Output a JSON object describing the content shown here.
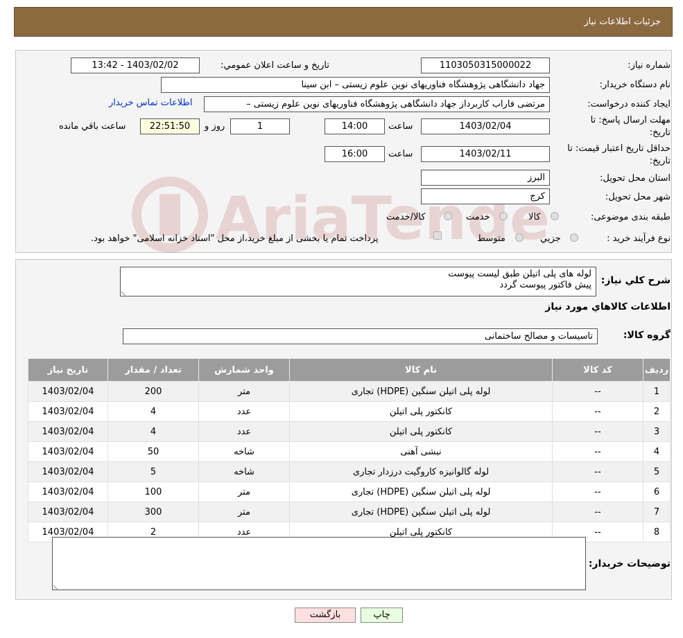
{
  "header": {
    "title": "جزئیات اطلاعات نیاز"
  },
  "form": {
    "need_number_label": "شماره نیاز:",
    "need_number": "1103050315000022",
    "announce_label": "تاریخ و ساعت اعلان عمومي:",
    "announce_value": "1403/02/02 - 13:42",
    "buyer_org_label": "نام دستگاه خريدار:",
    "buyer_org": "جهاد دانشگاهی پژوهشگاه فناوریهای نوین علوم زیستی – ابن سینا",
    "requester_label": "ايجاد كننده درخواست:",
    "requester": "مرتضی فاراب کاربرداز جهاد دانشگاهی پژوهشگاه فناوریهای نوین علوم زیستی –",
    "contact_link": "اطلاعات تماس خریدار",
    "deadline_label_1": "مهلت ارسال پاسخ: تا",
    "deadline_label_2": "تاریخ:",
    "deadline_date": "1403/02/04",
    "time_label": "ساعت",
    "deadline_time": "14:00",
    "days_value": "1",
    "days_label": "روز و",
    "remaining_time": "22:51:50",
    "remaining_label": "ساعت باقي مانده",
    "validity_label_1": "حداقل تاريخ اعتبار قيمت: تا",
    "validity_label_2": "تاریخ:",
    "validity_date": "1403/02/11",
    "validity_time": "16:00",
    "province_label": "استان محل تحویل:",
    "province": "البرز",
    "city_label": "شهر محل تحویل:",
    "city": "کرج",
    "category_label": "طبقه بندی موضوعی:",
    "category_options": [
      "کالا",
      "خدمت",
      "کالا/خدمت"
    ],
    "process_label": "نوع فرآیند خرید :",
    "process_options": [
      "جزیي",
      "متوسط"
    ],
    "process_note": "پرداخت تمام یا بخشی از مبلغ خرید،از محل \"اسناد خزانه اسلامی\" خواهد بود."
  },
  "description": {
    "label": "شرح كلي نياز:",
    "line1": "لوله های پلی اتیلن طبق لیست پیوست",
    "line2": "پیش فاکتور پیوست گردد"
  },
  "goods": {
    "section_title": "اطلاعات كالاهاي مورد نياز",
    "group_label": "گروه كالا:",
    "group_value": "تاسیسات و مصالح ساختمانی",
    "columns": [
      "رديف",
      "كد كالا",
      "نام كالا",
      "واحد شمارش",
      "تعداد / مقدار",
      "تاريخ نياز"
    ],
    "rows": [
      [
        "1",
        "--",
        "لوله پلی اتیلن سنگین (HDPE) تجاری",
        "متر",
        "200",
        "1403/02/04"
      ],
      [
        "2",
        "--",
        "کانکتور پلی اتیلن",
        "عدد",
        "4",
        "1403/02/04"
      ],
      [
        "3",
        "--",
        "کانکتور پلی اتیلن",
        "عدد",
        "4",
        "1403/02/04"
      ],
      [
        "4",
        "--",
        "نبشی آهنی",
        "شاخه",
        "50",
        "1403/02/04"
      ],
      [
        "5",
        "--",
        "لوله گالوانیزه کاروگیت درزدار تجاری",
        "شاخه",
        "5",
        "1403/02/04"
      ],
      [
        "6",
        "--",
        "لوله پلی اتیلن سنگین (HDPE) تجاری",
        "متر",
        "100",
        "1403/02/04"
      ],
      [
        "7",
        "--",
        "لوله پلی اتیلن سنگین (HDPE) تجاری",
        "متر",
        "300",
        "1403/02/04"
      ],
      [
        "8",
        "--",
        "کانکتور پلی اتیلن",
        "عدد",
        "2",
        "1403/02/04"
      ]
    ]
  },
  "buyer_notes": {
    "label": "توضيحات خريدار:",
    "value": ""
  },
  "buttons": {
    "print": "چاپ",
    "back": "بازگشت"
  },
  "colors": {
    "header": "#8b6a40",
    "table_header": "#9c9c9c",
    "link": "#0033cc",
    "back_button": "#ffe0e0",
    "print_button": "#e8ffe0"
  }
}
